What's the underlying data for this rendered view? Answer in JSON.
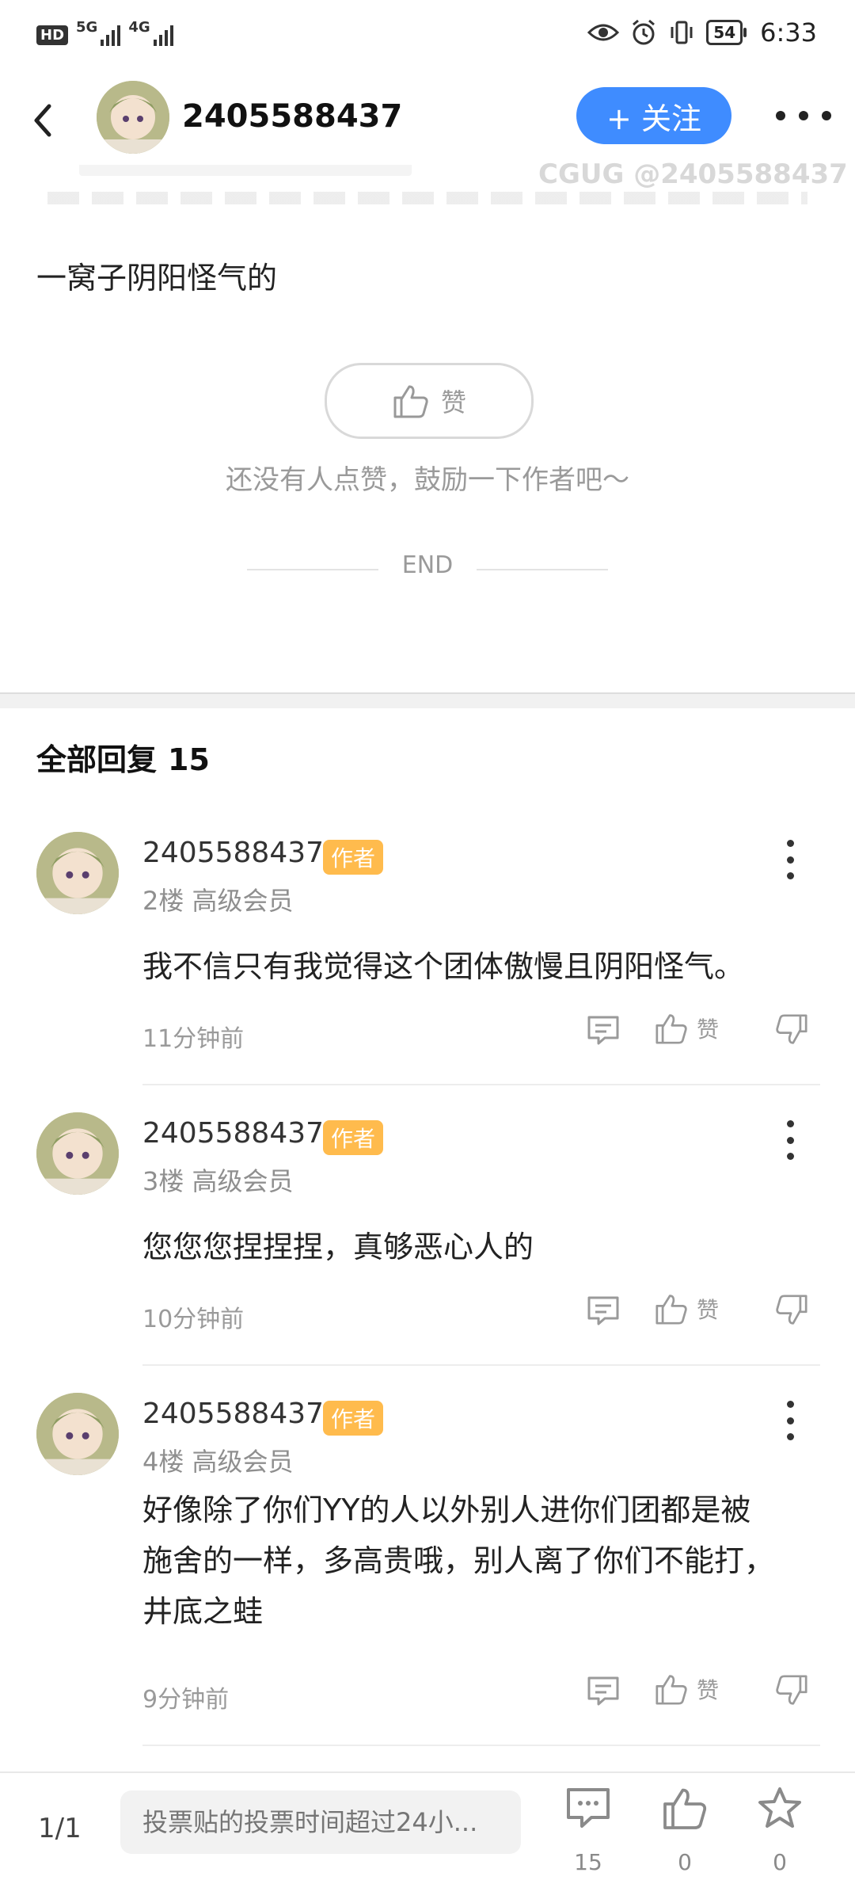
{
  "status_bar": {
    "left_icons": [
      "HD",
      "5G",
      "4G"
    ],
    "battery": "54",
    "time": "6:33"
  },
  "header": {
    "title": "2405588437",
    "follow_label": "+ 关注"
  },
  "post": {
    "watermark": "CGUG @2405588437",
    "text": "一窝子阴阳怪气的",
    "like_label": "赞",
    "like_hint": "还没有人点赞，鼓励一下作者吧～",
    "end_label": "END"
  },
  "replies": {
    "heading": "全部回复",
    "count": "15",
    "items": [
      {
        "name": "2405588437",
        "badge": "作者",
        "floor": "2楼 高级会员",
        "text": "我不信只有我觉得这个团体傲慢且阴阳怪气。",
        "time": "11分钟前",
        "like_label": "赞"
      },
      {
        "name": "2405588437",
        "badge": "作者",
        "floor": "3楼 高级会员",
        "text": "您您您捏捏捏，真够恶心人的",
        "time": "10分钟前",
        "like_label": "赞"
      },
      {
        "name": "2405588437",
        "badge": "作者",
        "floor": "4楼 高级会员",
        "text_lines": [
          "好像除了你们YY的人以外别人进你们团都是被",
          "施舍的一样，多高贵哦，别人离了你们不能打，",
          "井底之蛙"
        ],
        "time": "9分钟前",
        "like_label": "赞"
      }
    ]
  },
  "bottom_bar": {
    "page": "1/1",
    "input_placeholder": "投票贴的投票时间超过24小...",
    "comment_count": "15",
    "like_count": "0",
    "favorite_count": "0"
  },
  "colors": {
    "accent": "#3f8cff",
    "author_badge": "#ffbb4d",
    "secondary_text": "#9a9a9a"
  },
  "icons": [
    "back-arrow-icon",
    "more-icon",
    "thumbs-up-icon",
    "comment-icon",
    "thumbs-down-icon",
    "star-icon"
  ]
}
